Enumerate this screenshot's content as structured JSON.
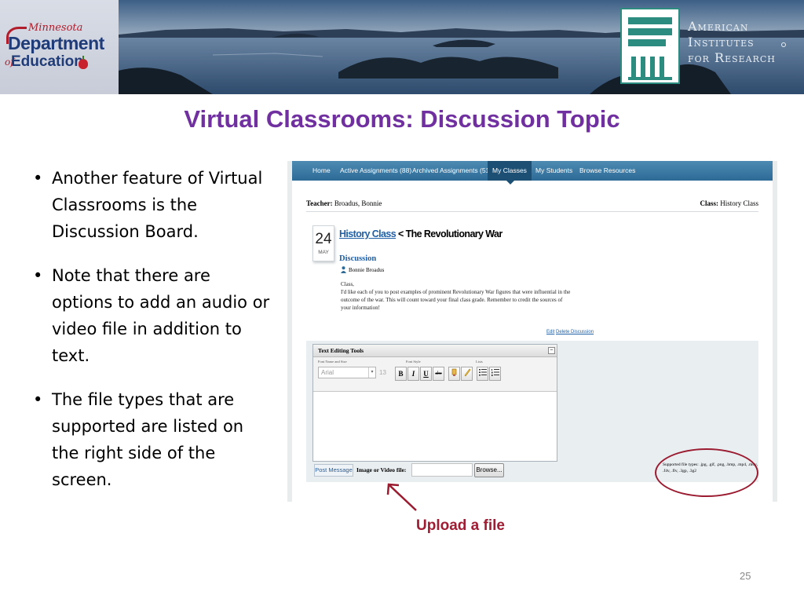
{
  "header": {
    "mde_logo": {
      "script_text": "Minnesota",
      "department": "Department",
      "of_text": "of",
      "education": "Education"
    },
    "air_logo": {
      "lines": [
        "American",
        "Institutes",
        "for Research"
      ]
    }
  },
  "slide": {
    "title": "Virtual Classrooms: Discussion Topic",
    "bullets": [
      "Another feature of Virtual Classrooms is the Discussion Board.",
      "Note that there are options to add an audio or video file in addition to text.",
      "The file types that are supported are listed on the right side of the screen."
    ],
    "annotation_label": "Upload a file",
    "page_number": "25"
  },
  "screenshot": {
    "nav": {
      "items": [
        {
          "label": "Home",
          "active": false
        },
        {
          "label": "Active Assignments (88)",
          "active": false
        },
        {
          "label": "Archived Assignments (51)",
          "active": false
        },
        {
          "label": "My Classes",
          "active": true
        },
        {
          "label": "My Students",
          "active": false
        },
        {
          "label": "Browse Resources",
          "active": false
        }
      ]
    },
    "teacher_label": "Teacher:",
    "teacher_name": "Broadus, Bonnie",
    "class_label": "Class:",
    "class_name": "History Class",
    "date": {
      "day": "24",
      "month": "MAY"
    },
    "breadcrumb": {
      "class_link": "History Class",
      "separator": "<",
      "topic": "The Revolutionary War"
    },
    "discussion_title": "Discussion",
    "author": "Bonnie Broadus",
    "message_lines": [
      "Class,",
      "I'd like each of you to post examples of prominent Revolutionary War figures that were influential in the",
      "outcome of the war.  This will count toward your final class grade.  Remember to credit the sources of",
      "your information!"
    ],
    "edit_link": "Edit",
    "delete_link": "Delete Discussion",
    "editor": {
      "panel_title": "Text Editing Tools",
      "collapse_symbol": "−",
      "group_font": "Font Name and Size",
      "group_style": "Font Style",
      "group_lists": "Lists",
      "font_value": "Arial",
      "size_value": "13",
      "bold": "B",
      "italic": "I",
      "underline": "U",
      "strike": "abc"
    },
    "post_button": "Post Message",
    "file_label": "Image or Video file:",
    "browse_button": "Browse...",
    "supported_types": "Supported file types: .jpg, .gif, .png, .bmp, .mp4, .mov, .f4v, .flv, .3gp, .3g2"
  },
  "colors": {
    "title_purple": "#7030a0",
    "annotation_red": "#a01c33",
    "nav_blue": "#2d6a96",
    "link_blue": "#1f5fa6",
    "air_teal": "#2d8c80"
  }
}
